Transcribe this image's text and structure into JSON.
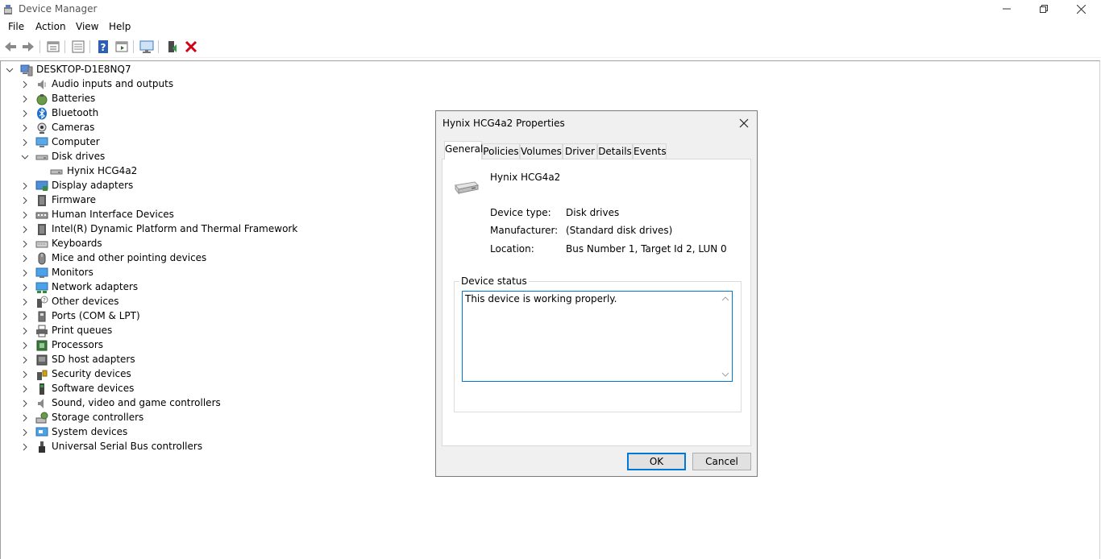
{
  "window": {
    "title": "Device Manager"
  },
  "menu": [
    "File",
    "Action",
    "View",
    "Help"
  ],
  "toolbar_icons": [
    "back-icon",
    "forward-icon",
    "properties-view-icon",
    "show-hidden-icon",
    "help-icon",
    "resource-view-icon",
    "scan-hardware-icon",
    "update-driver-icon",
    "uninstall-device-icon"
  ],
  "tree": {
    "root": "DESKTOP-D1E8NQ7",
    "categories": [
      {
        "label": "Audio inputs and outputs",
        "icon": "speaker-icon"
      },
      {
        "label": "Batteries",
        "icon": "battery-icon"
      },
      {
        "label": "Bluetooth",
        "icon": "bluetooth-icon"
      },
      {
        "label": "Cameras",
        "icon": "camera-icon"
      },
      {
        "label": "Computer",
        "icon": "computer-icon"
      },
      {
        "label": "Disk drives",
        "icon": "disk-drive-icon",
        "expanded": true,
        "children": [
          "Hynix HCG4a2"
        ]
      },
      {
        "label": "Display adapters",
        "icon": "display-adapter-icon"
      },
      {
        "label": "Firmware",
        "icon": "firmware-icon"
      },
      {
        "label": "Human Interface Devices",
        "icon": "hid-icon"
      },
      {
        "label": "Intel(R) Dynamic Platform and Thermal Framework",
        "icon": "thermal-icon"
      },
      {
        "label": "Keyboards",
        "icon": "keyboard-icon"
      },
      {
        "label": "Mice and other pointing devices",
        "icon": "mouse-icon"
      },
      {
        "label": "Monitors",
        "icon": "monitor-icon"
      },
      {
        "label": "Network adapters",
        "icon": "network-icon"
      },
      {
        "label": "Other devices",
        "icon": "unknown-device-icon"
      },
      {
        "label": "Ports (COM & LPT)",
        "icon": "port-icon"
      },
      {
        "label": "Print queues",
        "icon": "printer-icon"
      },
      {
        "label": "Processors",
        "icon": "processor-icon"
      },
      {
        "label": "SD host adapters",
        "icon": "sd-card-icon"
      },
      {
        "label": "Security devices",
        "icon": "security-icon"
      },
      {
        "label": "Software devices",
        "icon": "software-device-icon"
      },
      {
        "label": "Sound, video and game controllers",
        "icon": "sound-icon"
      },
      {
        "label": "Storage controllers",
        "icon": "storage-controller-icon"
      },
      {
        "label": "System devices",
        "icon": "system-device-icon"
      },
      {
        "label": "Universal Serial Bus controllers",
        "icon": "usb-icon"
      }
    ]
  },
  "dialog": {
    "title": "Hynix HCG4a2 Properties",
    "tabs": [
      "General",
      "Policies",
      "Volumes",
      "Driver",
      "Details",
      "Events"
    ],
    "active_tab": "General",
    "device_name": "Hynix HCG4a2",
    "fields": [
      {
        "label": "Device type:",
        "value": "Disk drives"
      },
      {
        "label": "Manufacturer:",
        "value": "(Standard disk drives)"
      },
      {
        "label": "Location:",
        "value": "Bus Number 1, Target Id 2, LUN 0"
      }
    ],
    "status_group_label": "Device status",
    "status_text": "This device is working properly.",
    "ok_label": "OK",
    "cancel_label": "Cancel"
  },
  "colors": {
    "accent": "#0078d7",
    "close_red": "#d0021b"
  }
}
